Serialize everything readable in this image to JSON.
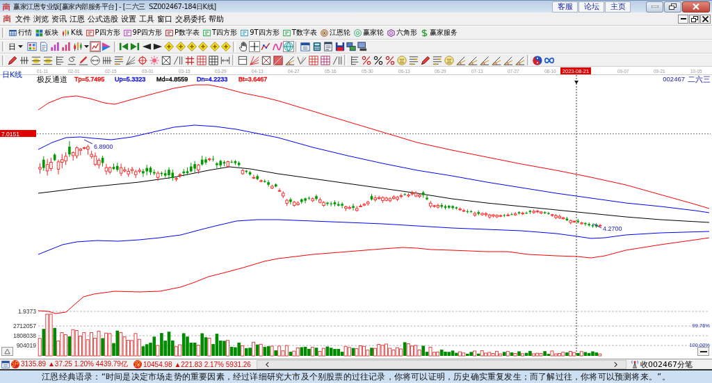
{
  "window": {
    "title": "赢家江恩专业版[赢家内部服务平台] - [二六三  SZ002467-184日K线]",
    "links": [
      "客服",
      "论坛",
      "主页"
    ]
  },
  "menu": [
    "文件",
    "浏览",
    "资讯",
    "江恩",
    "公式选股",
    "设置",
    "工具",
    "窗口",
    "交易委托",
    "帮助"
  ],
  "toolbar": [
    "行情",
    "板块",
    "K线",
    "P四方形",
    "9P四方形",
    "P数字表",
    "T四方形",
    "9T四方形",
    "T数字表",
    "江恩轮",
    "赢家轮",
    "六角形",
    "赢家服务"
  ],
  "toolbar_2": {
    "period": "日",
    "buttons": [
      {
        "pressed": false
      },
      {
        "pressed": false
      },
      {
        "pressed": false
      },
      {
        "pressed": false
      },
      {
        "pressed": false
      },
      {
        "pressed": true
      },
      {
        "pressed": false
      },
      {
        "pressed": false
      },
      {
        "pressed": false
      },
      {
        "pressed": false
      },
      {
        "pressed": false
      },
      {
        "pressed": false
      },
      {
        "pressed": false
      },
      {
        "pressed": false
      },
      {
        "pressed": false
      },
      {
        "pressed": false
      },
      {
        "pressed": false
      },
      {
        "pressed": false
      },
      {
        "pressed": true
      },
      {
        "pressed": false
      },
      {
        "pressed": false
      },
      {
        "pressed": true
      },
      {
        "pressed": false
      },
      {
        "pressed": false
      },
      {
        "pressed": false
      },
      {
        "pressed": false
      },
      {
        "pressed": false
      },
      {
        "pressed": false
      }
    ]
  },
  "chart": {
    "period_label": "日K线",
    "date_ticks": [
      "01-11",
      "02-01",
      "02-15",
      "03-01",
      "03-15",
      "03-29",
      "04-13",
      "04-27",
      "05-16",
      "05-30",
      "06-13",
      "06-29",
      "07-13",
      "07-27",
      "08-10",
      "09-07",
      "09-21",
      "10-05"
    ],
    "cursor_date": "2023-08-21",
    "indicator": {
      "name": "极反通道",
      "values": [
        {
          "text": "Tp=5.7495",
          "color": "#ff0000"
        },
        {
          "text": "Up=5.3323",
          "color": "#0000ff"
        },
        {
          "text": "Md=4.8559",
          "color": "#000000"
        },
        {
          "text": "Dn=4.2233",
          "color": "#0000ff"
        },
        {
          "text": "Bt=3.6467",
          "color": "#ff0000"
        }
      ]
    },
    "symbol": "002467",
    "stock_name": "二六三",
    "cursor_price": "7.0151",
    "high_label": "6.8900",
    "low_label": "4.2700",
    "volume_labels": [
      "1.9373",
      "2712057",
      "1808038",
      "904019"
    ],
    "right_labels": [
      "99.76%",
      "100.00%"
    ]
  },
  "status_bar": {
    "indices": [
      {
        "badge": "沪",
        "text": "3135.89 ▲37.25 1.20% 4439.79亿"
      },
      {
        "badge": "深",
        "text": "10454.98 ▲221.83 2.17% 5931.26"
      }
    ],
    "feed_label": "收002467分笔"
  },
  "ticker": "江恩经典语录：“时间是决定市场走势的重要因素，经过详细研究大市及个别股票的过往记录，你将可以证明，历史确实重复发生；而了解过往，你将可以预测将来。”。"
}
